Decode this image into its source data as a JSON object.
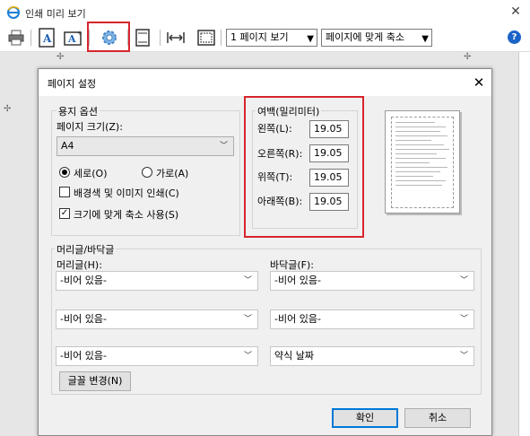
{
  "window": {
    "title": "인쇄 미리 보기",
    "close_label": "✕"
  },
  "toolbar": {
    "print_icon": "printer-icon",
    "page_view_select": "1 페이지 보기",
    "fit_select": "페이지에 맞게 축소",
    "help_label": "?",
    "highlight_color": "#d6262c"
  },
  "dialog": {
    "title": "페이지 설정",
    "close_label": "✕",
    "paper_options": {
      "group_label": "용지 옵션",
      "size_label": "페이지 크기(Z):",
      "size_value": "A4",
      "portrait_label": "세로(O)",
      "landscape_label": "가로(A)",
      "orientation_selected": "portrait",
      "bg_print_label": "배경색 및 이미지 인쇄(C)",
      "bg_print_checked": false,
      "shrink_label": "크기에 맞게 축소 사용(S)",
      "shrink_checked": true
    },
    "margins": {
      "group_label": "여백(밀리미터)",
      "left_label": "왼쪽(L):",
      "left_value": "19.05",
      "right_label": "오른쪽(R):",
      "right_value": "19.05",
      "top_label": "위쪽(T):",
      "top_value": "19.05",
      "bottom_label": "아래쪽(B):",
      "bottom_value": "19.05"
    },
    "header_footer": {
      "group_label": "머리글/바닥글",
      "header_label": "머리글(H):",
      "footer_label": "바닥글(F):",
      "header_values": [
        "-비어 있음-",
        "-비어 있음-",
        "-비어 있음-"
      ],
      "footer_values": [
        "-비어 있음-",
        "-비어 있음-",
        "약식 날짜"
      ],
      "font_button": "글꼴 변경(N)"
    },
    "ok_label": "확인",
    "cancel_label": "취소"
  }
}
